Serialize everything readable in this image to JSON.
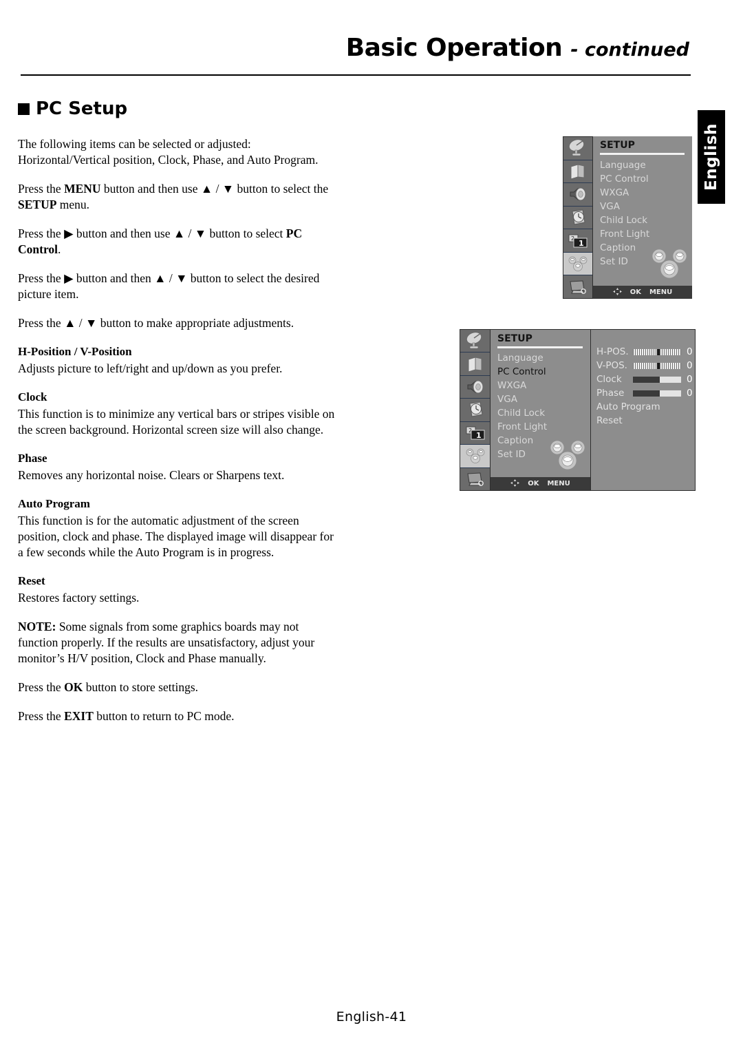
{
  "header": {
    "title_main": "Basic Operation",
    "title_sub": "- continued"
  },
  "section": {
    "heading": "PC Setup"
  },
  "lang_tab": {
    "label": "English"
  },
  "footer": {
    "page_label": "English-41"
  },
  "body": {
    "intro": "The following items can be selected or adjusted: Horizontal/Vertical position, Clock, Phase, and Auto Program.",
    "step_menu_pre": "Press the ",
    "step_menu_b1": "MENU",
    "step_menu_mid": " button and then use ▲ / ▼ button to select the ",
    "step_menu_b2": "SETUP",
    "step_menu_end": " menu.",
    "step_pc_pre": "Press the ▶ button and then use ▲ / ▼ button to select ",
    "step_pc_b": "PC Control",
    "step_pc_end": ".",
    "step_item": "Press the ▶ button and then ▲ / ▼ button to select the desired picture item.",
    "step_adjust": "Press the ▲ / ▼ button to make appropriate adjustments.",
    "h_position_title": "H-Position / V-Position",
    "h_position_text": "Adjusts picture to left/right and up/down as you prefer.",
    "clock_title": "Clock",
    "clock_text": "This function is to minimize any vertical bars or stripes visible on the screen background. Horizontal screen size will also change.",
    "phase_title": "Phase",
    "phase_text": "Removes any horizontal noise. Clears or Sharpens text.",
    "auto_program_title": "Auto Program",
    "auto_program_text": "This function is for the automatic adjustment of the screen position, clock and phase. The displayed image will disappear for a few seconds while the Auto Program is in progress.",
    "reset_title": "Reset",
    "reset_text": "Restores factory settings.",
    "note_label": "NOTE:",
    "note_text": " Some signals from some graphics boards may not function properly. If the results are unsatisfactory, adjust your monitor’s H/V position, Clock and Phase manually.",
    "ok_pre": "Press the ",
    "ok_b": "OK",
    "ok_end": " button to store settings.",
    "exit_pre": "Press the ",
    "exit_b": "EXIT",
    "exit_end": " button to return to PC mode."
  },
  "osd": {
    "title": "SETUP",
    "side_icons": [
      "satellite-dish-icon",
      "picture-screen-icon",
      "speaker-icon",
      "clock-icon",
      "pip-icon",
      "gears-setup-icon",
      "monitor-search-icon"
    ],
    "menu_items": [
      "Language",
      "PC Control",
      "WXGA",
      "VGA",
      "Child Lock",
      "Front Light",
      "Caption",
      "Set ID"
    ],
    "active_item": "PC Control",
    "bottom_bar": {
      "nav_icon": "four-way-arrows-icon",
      "ok_label": "OK",
      "menu_label": "MENU"
    },
    "submenu": {
      "rows": [
        {
          "label": "H-POS.",
          "type": "dash",
          "value": "0",
          "pos": 50
        },
        {
          "label": "V-POS.",
          "type": "dash",
          "value": "0",
          "pos": 50
        },
        {
          "label": "Clock",
          "type": "solid",
          "value": "0",
          "pos": 55
        },
        {
          "label": "Phase",
          "type": "solid",
          "value": "0",
          "pos": 55
        }
      ],
      "plain_rows": [
        "Auto Program",
        "Reset"
      ]
    }
  },
  "colors": {
    "osd_panel": "#8d8d8d",
    "osd_side": "#6b6b6b",
    "osd_side_selected": "#c9c9c9",
    "osd_bottom_bar": "#3a3a3a",
    "osd_item": "#d9d9d9",
    "osd_item_active": "#111111",
    "accent_black": "#000000"
  }
}
